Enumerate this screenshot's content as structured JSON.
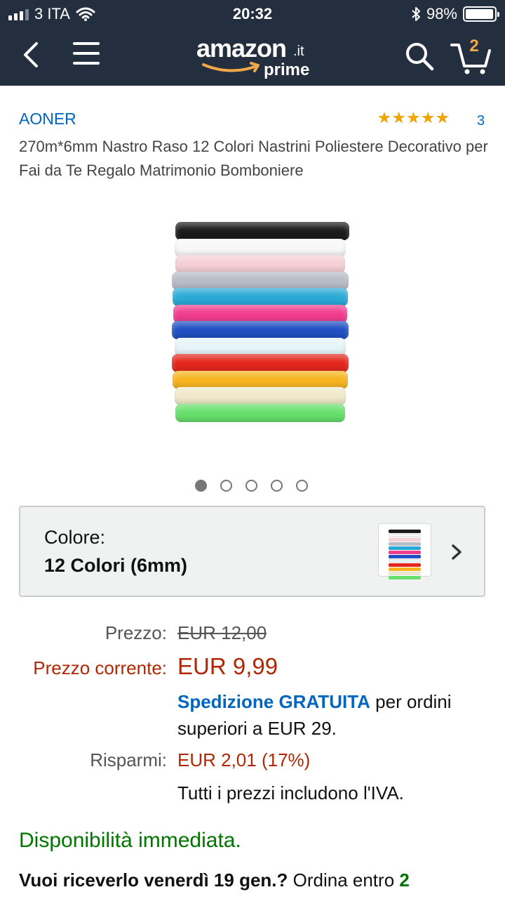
{
  "status_bar": {
    "carrier": "3 ITA",
    "time": "20:32",
    "battery": "98%",
    "battery_level": 0.98
  },
  "header": {
    "logo_word": "amazon",
    "logo_tld": ".it",
    "logo_prime": "prime",
    "cart_count": "2"
  },
  "product": {
    "brand": "AONER",
    "rating_stars": 5,
    "rating_count": "3",
    "title": "270m*6mm Nastro Raso 12 Colori Nastrini Poliestere Decorativo per Fai da Te Regalo Matrimonio Bomboniere",
    "ribbon_colors": [
      "#1b1b1b",
      "#f7f7f9",
      "#f4cfd6",
      "#b7bcc6",
      "#2aa9d6",
      "#f03d8e",
      "#1f4fc2",
      "#e4f4f7",
      "#e3271c",
      "#f6b41f",
      "#efe9c9",
      "#66e06b"
    ],
    "image_count": 5,
    "active_image": 0
  },
  "selector": {
    "label": "Colore:",
    "value": "12 Colori (6mm)"
  },
  "pricing": {
    "list_label": "Prezzo:",
    "list_value": "EUR 12,00",
    "current_label": "Prezzo corrente:",
    "current_value": "EUR 9,99",
    "shipping_free": "Spedizione GRATUITA",
    "shipping_rest": " per ordini superiori a EUR 29.",
    "savings_label": "Risparmi:",
    "savings_value": "EUR 2,01 (17%)",
    "vat_note": "Tutti i prezzi includono l'IVA."
  },
  "availability": "Disponibilità immediata.",
  "delivery": {
    "bold": "Vuoi riceverlo venerdì 19 gen.?",
    "text": " Ordina entro ",
    "countdown": "2"
  },
  "colors": {
    "header_bg": "#232f3e",
    "link": "#0066c0",
    "price_red": "#b12704",
    "in_stock_green": "#007600",
    "star": "#f0a500",
    "cart_orange": "#f3a847"
  }
}
